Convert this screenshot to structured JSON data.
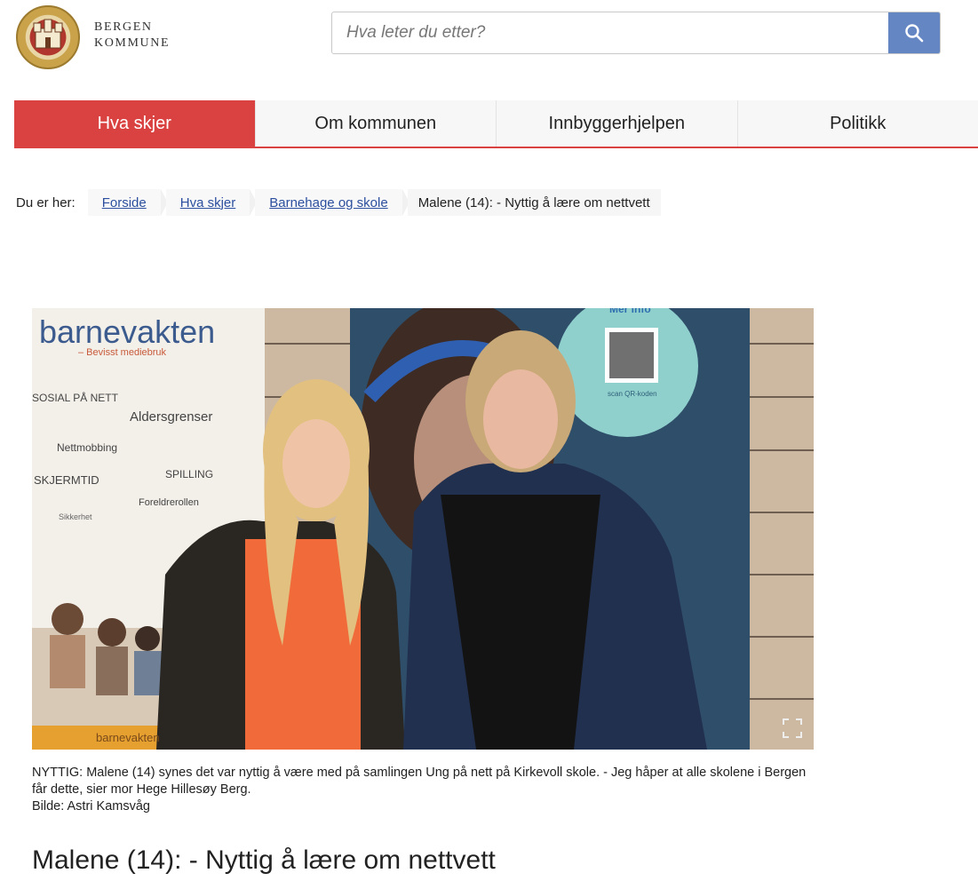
{
  "header": {
    "brand_line1": "BERGEN",
    "brand_line2": "KOMMUNE",
    "search_placeholder": "Hva leter du etter?",
    "search_icon": "search-icon"
  },
  "nav": {
    "tabs": [
      {
        "label": "Hva skjer",
        "active": true
      },
      {
        "label": "Om kommunen",
        "active": false
      },
      {
        "label": "Innbyggerhjelpen",
        "active": false
      },
      {
        "label": "Politikk",
        "active": false
      }
    ]
  },
  "breadcrumb": {
    "label": "Du er her:",
    "items": [
      "Forside",
      "Hva skjer",
      "Barnehage og skole"
    ],
    "current": "Malene (14): - Nyttig å lære om nettvett"
  },
  "photo": {
    "banner_title": "barnevakten",
    "banner_tagline": "– Bevisst mediebruk",
    "banner_words": [
      "SOSIAL PÅ NETT",
      "Aldersgrenser",
      "Nettmobbing",
      "SPILLING",
      "SKJERMTID",
      "Foreldrerollen",
      "Sikkerhet"
    ],
    "banner_footer": "barnevakten",
    "poster_circle_title": "Mer info",
    "poster_circle_sub": "scan QR-koden",
    "expand_icon": "expand-icon"
  },
  "caption": {
    "text": "NYTTIG: Malene (14) synes det var nyttig å være med på samlingen Ung på nett på Kirkevoll skole. - Jeg håper at alle skolene i Bergen får dette, sier mor Hege Hillesøy Berg.",
    "credit": "Bilde: Astri Kamsvåg"
  },
  "article": {
    "title": "Malene (14): - Nyttig å lære om nettvett"
  },
  "colors": {
    "accent_red": "#d94240",
    "search_blue": "#6487c4",
    "link_blue": "#2b4f9e"
  }
}
